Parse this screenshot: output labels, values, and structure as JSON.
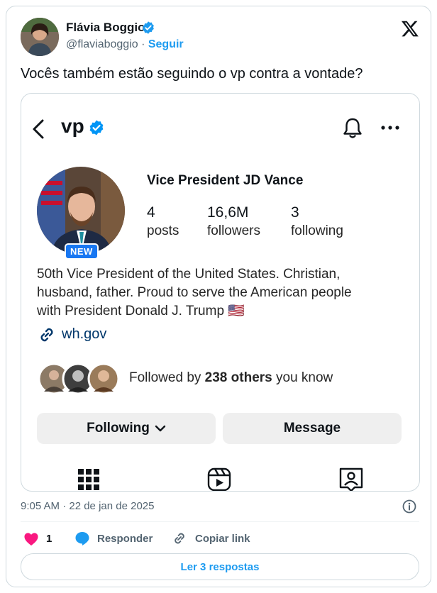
{
  "tweet": {
    "author": {
      "name": "Flávia Boggio",
      "handle": "@flaviaboggio",
      "separator": " · ",
      "follow_label": "Seguir"
    },
    "text": "Vocês também estão seguindo o vp contra a vontade?",
    "timestamp": "9:05 AM · 22 de jan de 2025",
    "actions": {
      "like_count": "1",
      "reply_label": "Responder",
      "copy_link_label": "Copiar link"
    },
    "read_replies_label": "Ler 3 respostas"
  },
  "instagram_profile": {
    "username": "vp",
    "new_badge": "NEW",
    "display_name": "Vice President JD Vance",
    "stats": [
      {
        "value": "4",
        "label": "posts"
      },
      {
        "value": "16,6M",
        "label": "followers"
      },
      {
        "value": "3",
        "label": "following"
      }
    ],
    "bio_lines": [
      "50th Vice President of the United States. Christian,",
      "husband, father. Proud to serve the American people",
      "with President Donald J. Trump"
    ],
    "bio_flag": "🇺🇸",
    "link": "wh.gov",
    "mutual": {
      "prefix": "Followed by ",
      "count": "238 others",
      "suffix": " you know"
    },
    "buttons": {
      "following_label": "Following",
      "message_label": "Message"
    },
    "tabs": [
      "grid-icon",
      "reels-icon",
      "tagged-icon"
    ]
  },
  "colors": {
    "accent_blue": "#1d9bf0",
    "text": "#0f1419",
    "muted": "#536471",
    "like_red": "#f91880",
    "ig_new_badge": "#1877f2",
    "ig_link": "#00376b"
  }
}
